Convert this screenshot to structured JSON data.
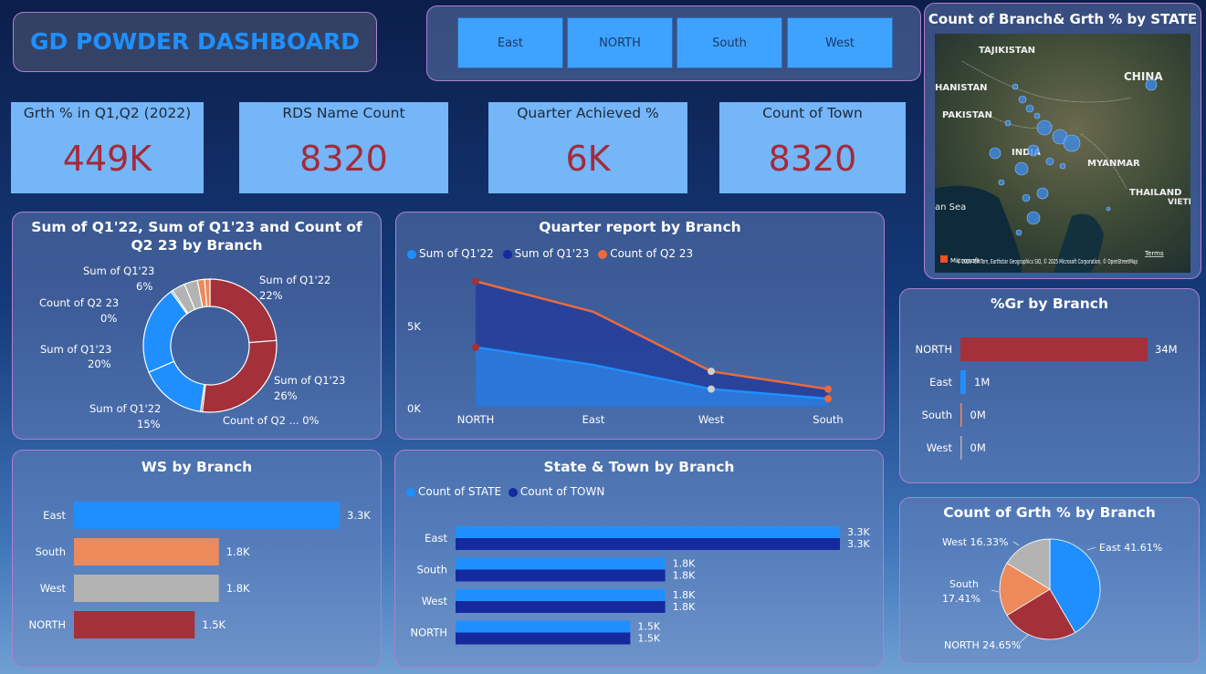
{
  "header": {
    "title": "GD POWDER DASHBOARD"
  },
  "slicer": {
    "items": [
      "East",
      "NORTH",
      "South",
      "West"
    ]
  },
  "kpis": [
    {
      "label": "Grth % in Q1,Q2 (2022)",
      "value": "449K"
    },
    {
      "label": "RDS Name Count",
      "value": "8320"
    },
    {
      "label": "Quarter Achieved %",
      "value": "6K"
    },
    {
      "label": "Count of Town",
      "value": "8320"
    }
  ],
  "map": {
    "title": "Count of Branch& Grth % by STATE",
    "labels": [
      "TAJIKISTAN",
      "CHINA",
      "HANISTAN",
      "PAKISTAN",
      "INDIA",
      "MYANMAR",
      "THAILAND",
      "VIETN",
      "an Sea"
    ],
    "attribution": "© 2025 TomTom, Earthstar Geographics SIO, © 2025 Microsoft Corporation, © OpenStreetMap",
    "terms": "Terms",
    "brand": "Microsoft"
  },
  "donut": {
    "title": "Sum of Q1'22, Sum of Q1'23 and Count of Q2 23 by Branch",
    "labels": [
      "Sum of Q1'22",
      "22%",
      "Sum of Q1'23",
      "26%",
      "Count of Q2 ... 0%",
      "Sum of Q1'22",
      "15%",
      "Sum of Q1'23",
      "20%",
      "Count of Q2 23",
      "0%",
      "Sum of Q1'23",
      "6%"
    ]
  },
  "quarter": {
    "title": "Quarter report by Branch",
    "legend": [
      "Sum of Q1'22",
      "Sum of Q1'23",
      "Count of Q2 23"
    ],
    "y_ticks": [
      "5K",
      "0K"
    ]
  },
  "gr": {
    "title": "%Gr by Branch"
  },
  "ws": {
    "title": "WS by Branch"
  },
  "state_town": {
    "title": "State & Town by Branch",
    "legend": [
      "Count of STATE",
      "Count of TOWN"
    ]
  },
  "pie": {
    "title": "Count of Grth % by Branch",
    "labels": [
      "East 41.61%",
      "NORTH 24.65%",
      "South",
      "17.41%",
      "West 16.33%"
    ]
  },
  "colors": {
    "blue": "#1f8fff",
    "navy": "#142a9e",
    "orange": "#ec8a5c",
    "grey": "#b3b3b3",
    "red": "#a4303a",
    "kpi_bg": "#74b6f8",
    "kpi_value": "#a52a3a",
    "title_blue": "#1e90ff"
  },
  "chart_data": [
    {
      "type": "pie",
      "title": "Sum of Q1'22, Sum of Q1'23 and Count of Q2 23 by Branch",
      "series": [
        {
          "name": "Sum of Q1'22",
          "values": [
            22,
            15
          ]
        },
        {
          "name": "Sum of Q1'23",
          "values": [
            26,
            20,
            6
          ]
        },
        {
          "name": "Count of Q2 23",
          "values": [
            0,
            0
          ]
        }
      ]
    },
    {
      "type": "area",
      "title": "Quarter report by Branch",
      "categories": [
        "NORTH",
        "East",
        "West",
        "South"
      ],
      "series": [
        {
          "name": "Sum of Q1'22",
          "values": [
            3700,
            2600,
            1100,
            500
          ]
        },
        {
          "name": "Sum of Q1'23",
          "values": [
            7800,
            5900,
            2200,
            1100
          ]
        },
        {
          "name": "Count of Q2 23",
          "values": [
            7800,
            5900,
            2200,
            1100
          ]
        }
      ],
      "ylim": [
        0,
        8500
      ],
      "y_ticks": [
        "5K",
        "0K"
      ]
    },
    {
      "type": "bar",
      "title": "%Gr by Branch",
      "categories": [
        "NORTH",
        "East",
        "South",
        "West"
      ],
      "values": [
        34,
        1,
        0,
        0
      ],
      "value_labels": [
        "34M",
        "1M",
        "0M",
        "0M"
      ]
    },
    {
      "type": "bar",
      "title": "WS by Branch",
      "categories": [
        "East",
        "South",
        "West",
        "NORTH"
      ],
      "values": [
        3.3,
        1.8,
        1.8,
        1.5
      ],
      "value_labels": [
        "3.3K",
        "1.8K",
        "1.8K",
        "1.5K"
      ]
    },
    {
      "type": "bar",
      "title": "State & Town by Branch",
      "categories": [
        "East",
        "South",
        "West",
        "NORTH"
      ],
      "series": [
        {
          "name": "Count of STATE",
          "values": [
            3.3,
            1.8,
            1.8,
            1.5
          ]
        },
        {
          "name": "Count of TOWN",
          "values": [
            3.3,
            1.8,
            1.8,
            1.5
          ]
        }
      ],
      "value_labels": [
        "3.3K",
        "1.8K",
        "1.5K"
      ]
    },
    {
      "type": "pie",
      "title": "Count of Grth % by Branch",
      "categories": [
        "East",
        "NORTH",
        "South",
        "West"
      ],
      "values": [
        41.61,
        24.65,
        17.41,
        16.33
      ]
    }
  ]
}
